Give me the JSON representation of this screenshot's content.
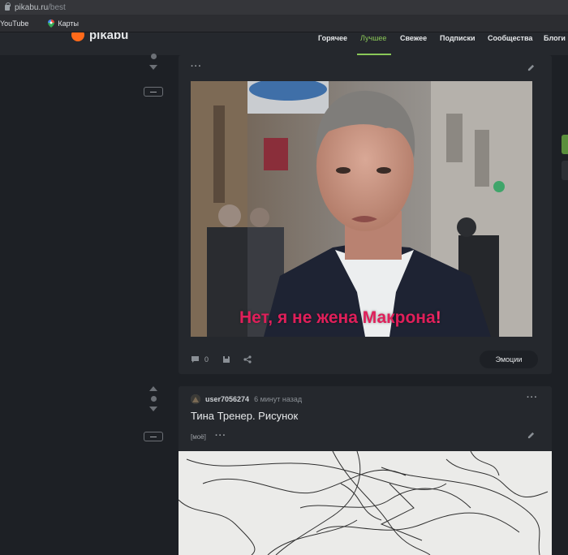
{
  "browser": {
    "url_domain": "pikabu.ru",
    "url_path": "/best",
    "bookmarks": [
      {
        "label": "YouTube"
      },
      {
        "label": "Карты"
      }
    ]
  },
  "site": {
    "logo": "pikabu",
    "nav": [
      "Горячее",
      "Лучшее",
      "Свежее",
      "Подписки",
      "Сообщества",
      "Блоги"
    ],
    "active_nav": "Лучшее"
  },
  "posts": [
    {
      "image_caption_text": "Нет, я не жена Макрона",
      "image_caption_bang": "!",
      "comments_count": "0",
      "emotions_label": "Эмоции"
    },
    {
      "author": "user7056274",
      "time": "6 минут назад",
      "title": "Тина Тренер. Рисунок",
      "tag": "[моё]"
    }
  ],
  "colors": {
    "accent": "#8ac858",
    "caption": "#e01f5a",
    "background": "#1d2025",
    "card": "#25282d"
  },
  "icons": [
    "lock-icon",
    "maps-pin-icon",
    "comment-icon",
    "save-icon",
    "share-icon",
    "edit-icon",
    "more-icon",
    "vote-up-icon",
    "vote-down-icon"
  ]
}
